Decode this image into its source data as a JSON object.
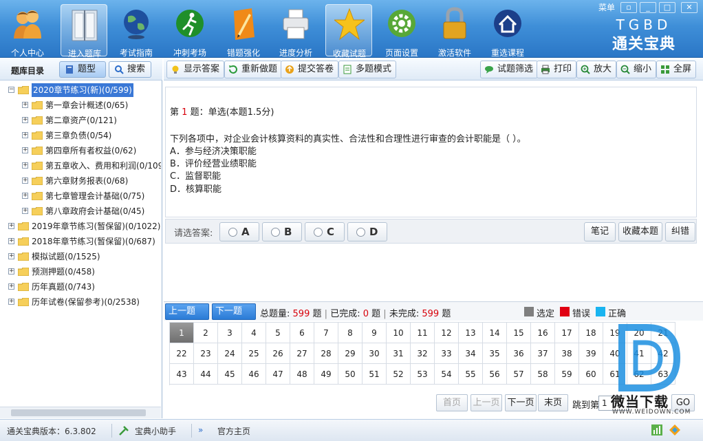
{
  "toolbar": {
    "items": [
      {
        "label": "个人中心",
        "icon": "users-icon"
      },
      {
        "label": "进入题库",
        "icon": "book-icon"
      },
      {
        "label": "考试指南",
        "icon": "globe-icon"
      },
      {
        "label": "冲刺考场",
        "icon": "runner-icon"
      },
      {
        "label": "错题强化",
        "icon": "pencil-icon"
      },
      {
        "label": "进度分析",
        "icon": "printer-icon"
      },
      {
        "label": "收藏试题",
        "icon": "star-icon"
      },
      {
        "label": "页面设置",
        "icon": "gear-icon"
      },
      {
        "label": "激活软件",
        "icon": "lock-icon"
      },
      {
        "label": "重选课程",
        "icon": "home-icon"
      }
    ],
    "brand_top": "TGBD",
    "brand_bottom": "通关宝典",
    "menu": "菜单"
  },
  "left": {
    "title": "题库目录",
    "btn_type": "题型",
    "btn_search": "搜索",
    "tree": [
      {
        "label": "2020章节练习(新)(0/599)",
        "level": 0,
        "selected": true,
        "expanded": true
      },
      {
        "label": "第一章会计概述(0/65)",
        "level": 1
      },
      {
        "label": "第二章资产(0/121)",
        "level": 1
      },
      {
        "label": "第三章负债(0/54)",
        "level": 1
      },
      {
        "label": "第四章所有者权益(0/62)",
        "level": 1
      },
      {
        "label": "第五章收入、费用和利润(0/109",
        "level": 1
      },
      {
        "label": "第六章财务报表(0/68)",
        "level": 1
      },
      {
        "label": "第七章管理会计基础(0/75)",
        "level": 1
      },
      {
        "label": "第八章政府会计基础(0/45)",
        "level": 1
      },
      {
        "label": "2019年章节练习(暂保留)(0/1022)",
        "level": 0
      },
      {
        "label": "2018年章节练习(暂保留)(0/687)",
        "level": 0
      },
      {
        "label": "模拟试题(0/1525)",
        "level": 0
      },
      {
        "label": "预测押题(0/458)",
        "level": 0
      },
      {
        "label": "历年真题(0/743)",
        "level": 0
      },
      {
        "label": "历年试卷(保留参考)(0/2538)",
        "level": 0
      }
    ]
  },
  "actions": {
    "show_answer": "显示答案",
    "redo": "重新做题",
    "submit": "提交答卷",
    "multi": "多题模式",
    "filter": "试题筛选",
    "print": "打印",
    "zoom_in": "放大",
    "zoom_out": "缩小",
    "fullscreen": "全屏"
  },
  "question": {
    "prefix": "第",
    "number": "1",
    "suffix": "题：单选(本题1.5分)",
    "stem": "下列各项中，对企业会计核算资料的真实性、合法性和合理性进行审查的会计职能是（ ）。",
    "options": [
      "A．参与经济决策职能",
      "B．评价经营业绩职能",
      "C．监督职能",
      "D．核算职能"
    ]
  },
  "answer": {
    "label": "请选答案:",
    "choices": [
      "A",
      "B",
      "C",
      "D"
    ],
    "note": "笔记",
    "fav": "收藏本题",
    "error": "纠错"
  },
  "nav": {
    "prev": "上一题(←)",
    "next": "下一题(→)",
    "total_label": "总题量:",
    "total": "599",
    "unit": "题",
    "done_label": "已完成:",
    "done": "0",
    "undone_label": "未完成:",
    "undone": "599",
    "legend": [
      {
        "label": "选定",
        "color": "#7f7f7f"
      },
      {
        "label": "错误",
        "color": "#e00012"
      },
      {
        "label": "正确",
        "color": "#19b4f0"
      }
    ]
  },
  "grid": {
    "numbers": [
      "1",
      "2",
      "3",
      "4",
      "5",
      "6",
      "7",
      "8",
      "9",
      "10",
      "11",
      "12",
      "13",
      "14",
      "15",
      "16",
      "17",
      "18",
      "19",
      "20",
      "21",
      "22",
      "23",
      "24",
      "25",
      "26",
      "27",
      "28",
      "29",
      "30",
      "31",
      "32",
      "33",
      "34",
      "35",
      "36",
      "37",
      "38",
      "39",
      "40",
      "41",
      "42",
      "43",
      "44",
      "45",
      "46",
      "47",
      "48",
      "49",
      "50",
      "51",
      "52",
      "53",
      "54",
      "55",
      "56",
      "57",
      "58",
      "59",
      "60",
      "61",
      "62",
      "63"
    ],
    "current": "1"
  },
  "pager": {
    "first": "首页",
    "prev": "上一页",
    "next": "下一页",
    "last": "末页",
    "jump_label": "跳到第",
    "jump_value": "1",
    "go": "GO"
  },
  "status": {
    "version": "通关宝典版本：6.3.802",
    "helper": "宝典小助手",
    "homepage": "官方主页"
  },
  "watermark": {
    "text": "微当下载",
    "url": "WWW.WEIDOWN.COM"
  }
}
